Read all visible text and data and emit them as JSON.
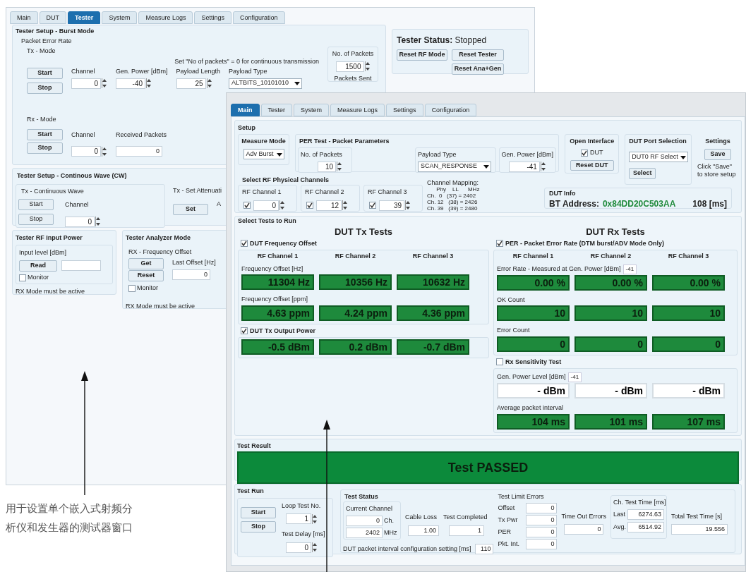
{
  "caption": [
    "用于设置单个嵌入式射频分",
    "析仪和发生器的测试器窗口"
  ],
  "tester_window": {
    "tabs": [
      {
        "label": "Main",
        "selected": false
      },
      {
        "label": "DUT",
        "selected": false
      },
      {
        "label": "Tester",
        "selected": true
      },
      {
        "label": "System",
        "selected": false
      },
      {
        "label": "Measure Logs",
        "selected": false
      },
      {
        "label": "Settings",
        "selected": false
      },
      {
        "label": "Configuration",
        "selected": false
      }
    ],
    "burst": {
      "title": "Tester Setup - Burst Mode",
      "subtitle": "Packet Error Rate",
      "tx": {
        "title": "Tx - Mode",
        "note": "Set \"No of packets\" = 0 for continuous transmission",
        "buttons": [
          "Start",
          "Stop"
        ],
        "fields": [
          {
            "label": "Channel",
            "value": "0",
            "kind": "spin"
          },
          {
            "label": "Gen. Power [dBm]",
            "value": "-40",
            "kind": "spin"
          },
          {
            "label": "Payload Length",
            "value": "25",
            "kind": "spin"
          },
          {
            "label": "Payload Type",
            "value": "ALTBITS_10101010",
            "kind": "dropdown"
          }
        ],
        "packets": {
          "label": "No. of Packets",
          "value": "1500"
        },
        "sent_label": "Packets Sent"
      },
      "rx": {
        "title": "Rx - Mode",
        "buttons": [
          "Start",
          "Stop"
        ],
        "fields": [
          {
            "label": "Channel",
            "value": "0",
            "kind": "spin"
          },
          {
            "label": "Received Packets",
            "value": "0",
            "kind": "text"
          }
        ]
      }
    },
    "status": {
      "label": "Tester Status:",
      "value": "Stopped",
      "buttons": [
        "Reset RF Mode",
        "Reset Tester",
        "Reset Ana+Gen"
      ]
    },
    "cw": {
      "title": "Tester Setup - Continous Wave (CW)",
      "tx": {
        "title": "Tx - Continuous Wave",
        "buttons": [
          "Start",
          "Stop"
        ],
        "channel": {
          "label": "Channel",
          "value": "0"
        }
      },
      "attenuation": {
        "title": "Tx - Set Attenuati",
        "button": "Set",
        "label": "A"
      }
    },
    "rf_input": {
      "title": "Tester RF Input Power",
      "group": "Input level [dBm]",
      "button": "Read",
      "monitor": {
        "label": "Monitor",
        "checked": false
      },
      "note": "RX Mode must be active"
    },
    "analyzer": {
      "title": "Tester Analyzer Mode",
      "group": "RX - Frequency Offset",
      "buttons": [
        "Get",
        "Reset"
      ],
      "field": {
        "label": "Last Offset [Hz]",
        "value": "0"
      },
      "monitor": {
        "label": "Monitor",
        "checked": false
      },
      "note": "RX Mode must be active"
    }
  },
  "main_window": {
    "tabs": [
      {
        "label": "Main",
        "selected": true
      },
      {
        "label": "Tester",
        "selected": false
      },
      {
        "label": "System",
        "selected": false
      },
      {
        "label": "Measure Logs",
        "selected": false
      },
      {
        "label": "Settings",
        "selected": false
      },
      {
        "label": "Configuration",
        "selected": false
      }
    ],
    "setup": {
      "title": "Setup",
      "measure_mode": {
        "label": "Measure Mode",
        "value": "Adv Burst"
      },
      "per": {
        "title": "PER Test - Packet Parameters",
        "packets": {
          "label": "No. of Packets",
          "value": "10"
        },
        "payload": {
          "label": "Payload Type",
          "value": "SCAN_RESPONSE"
        },
        "power": {
          "label": "Gen. Power [dBm]",
          "value": "-41"
        }
      },
      "open_interface": {
        "title": "Open Interface",
        "dut": {
          "label": "DUT",
          "checked": true
        },
        "button": "Reset DUT"
      },
      "port": {
        "title": "DUT Port Selection",
        "value": "DUT0 RF Select",
        "button": "Select"
      },
      "settings": {
        "title": "Settings",
        "button": "Save",
        "note": "Click \"Save\" to store setup"
      },
      "channels": {
        "title": "Select RF Physical Channels",
        "items": [
          {
            "label": "RF Channel 1",
            "checked": true,
            "value": "0"
          },
          {
            "label": "RF Channel 2",
            "checked": true,
            "value": "12"
          },
          {
            "label": "RF Channel 3",
            "checked": true,
            "value": "39"
          }
        ]
      },
      "mapping": {
        "title": "Channel Mapping:",
        "lines": [
          "      Phy    LL      MHz",
          "Ch.  0   (37) = 2402",
          "Ch. 12   (38) = 2426",
          "Ch. 39   (39) = 2480"
        ]
      },
      "dut_info": {
        "title": "DUT Info",
        "label": "BT Address:",
        "address": "0x84DD20C503AA",
        "time": "108 [ms]"
      }
    },
    "tests_title": "Select Tests to Run",
    "tx_tests": {
      "title": "DUT Tx Tests",
      "groups": [
        {
          "label": "DUT Frequency Offset",
          "checked": true,
          "columns": [
            "RF Channel 1",
            "RF Channel 2",
            "RF Channel 3"
          ],
          "rows": [
            {
              "label": "Frequency Offset [Hz]",
              "kind": "reading",
              "values": [
                "11304 Hz",
                "10356 Hz",
                "10632 Hz"
              ]
            },
            {
              "label": "Frequency Offset [ppm]",
              "kind": "reading",
              "values": [
                "4.63 ppm",
                "4.24 ppm",
                "4.36 ppm"
              ]
            }
          ]
        },
        {
          "label": "DUT Tx Output Power",
          "checked": true,
          "rows": [
            {
              "kind": "reading",
              "values": [
                "-0.5 dBm",
                "0.2 dBm",
                "-0.7 dBm"
              ]
            }
          ]
        }
      ]
    },
    "rx_tests": {
      "title": "DUT Rx Tests",
      "groups": [
        {
          "label": "PER - Packet Error Rate (DTM burst/ADV Mode Only)",
          "checked": true,
          "columns": [
            "RF Channel 1",
            "RF Channel 2",
            "RF Channel 3"
          ],
          "rows": [
            {
              "label": "Error Rate - Measured at Gen. Power [dBm]",
              "tag": "-41",
              "kind": "reading",
              "values": [
                "0.00 %",
                "0.00 %",
                "0.00 %"
              ]
            },
            {
              "label": "OK Count",
              "kind": "reading",
              "values": [
                "10",
                "10",
                "10"
              ]
            },
            {
              "label": "Error Count",
              "kind": "reading",
              "values": [
                "0",
                "0",
                "0"
              ]
            }
          ]
        },
        {
          "label": "Rx Sensitivity Test",
          "checked": false,
          "rows": [
            {
              "label": "Gen. Power Level [dBm]",
              "tag": "-41",
              "kind": "blank",
              "values": [
                "- dBm",
                "- dBm",
                "- dBm"
              ]
            },
            {
              "label": "Average packet interval",
              "kind": "reading",
              "values": [
                "104 ms",
                "101 ms",
                "107 ms"
              ]
            }
          ]
        }
      ]
    },
    "result": {
      "title": "Test Result",
      "text": "Test PASSED",
      "passed": true
    },
    "run": {
      "title": "Test Run",
      "buttons": [
        "Start",
        "Stop"
      ],
      "loop": {
        "label": "Loop Test No.",
        "value": "1"
      },
      "delay": {
        "label": "Test Delay [ms]",
        "value": "0"
      }
    },
    "status": {
      "title": "Test Status",
      "current": {
        "label": "Current Channel",
        "channel": "0",
        "channel_unit": "Ch.",
        "frequency": "2402",
        "frequency_unit": "MHz"
      },
      "cable_loss": {
        "label": "Cable Loss",
        "value": "1.00"
      },
      "completed": {
        "label": "Test Completed",
        "value": "1"
      },
      "interval": {
        "label": "DUT packet interval configuration setting [ms]",
        "value": "110"
      },
      "limits": {
        "title": "Test Limit Errors",
        "rows": [
          {
            "label": "Offset",
            "value": "0"
          },
          {
            "label": "Tx Pwr",
            "value": "0"
          },
          {
            "label": "PER",
            "value": "0"
          },
          {
            "label": "Pkt. Int.",
            "value": "0"
          }
        ]
      },
      "timeouts": {
        "label": "Time Out Errors",
        "value": "0"
      },
      "ch_time": {
        "title": "Ch. Test Time [ms]",
        "rows": [
          {
            "label": "Last",
            "value": "6274.63"
          },
          {
            "label": "Avg.",
            "value": "6514.92"
          }
        ]
      },
      "total": {
        "label": "Total Test Time [s]",
        "value": "19.556"
      }
    }
  }
}
